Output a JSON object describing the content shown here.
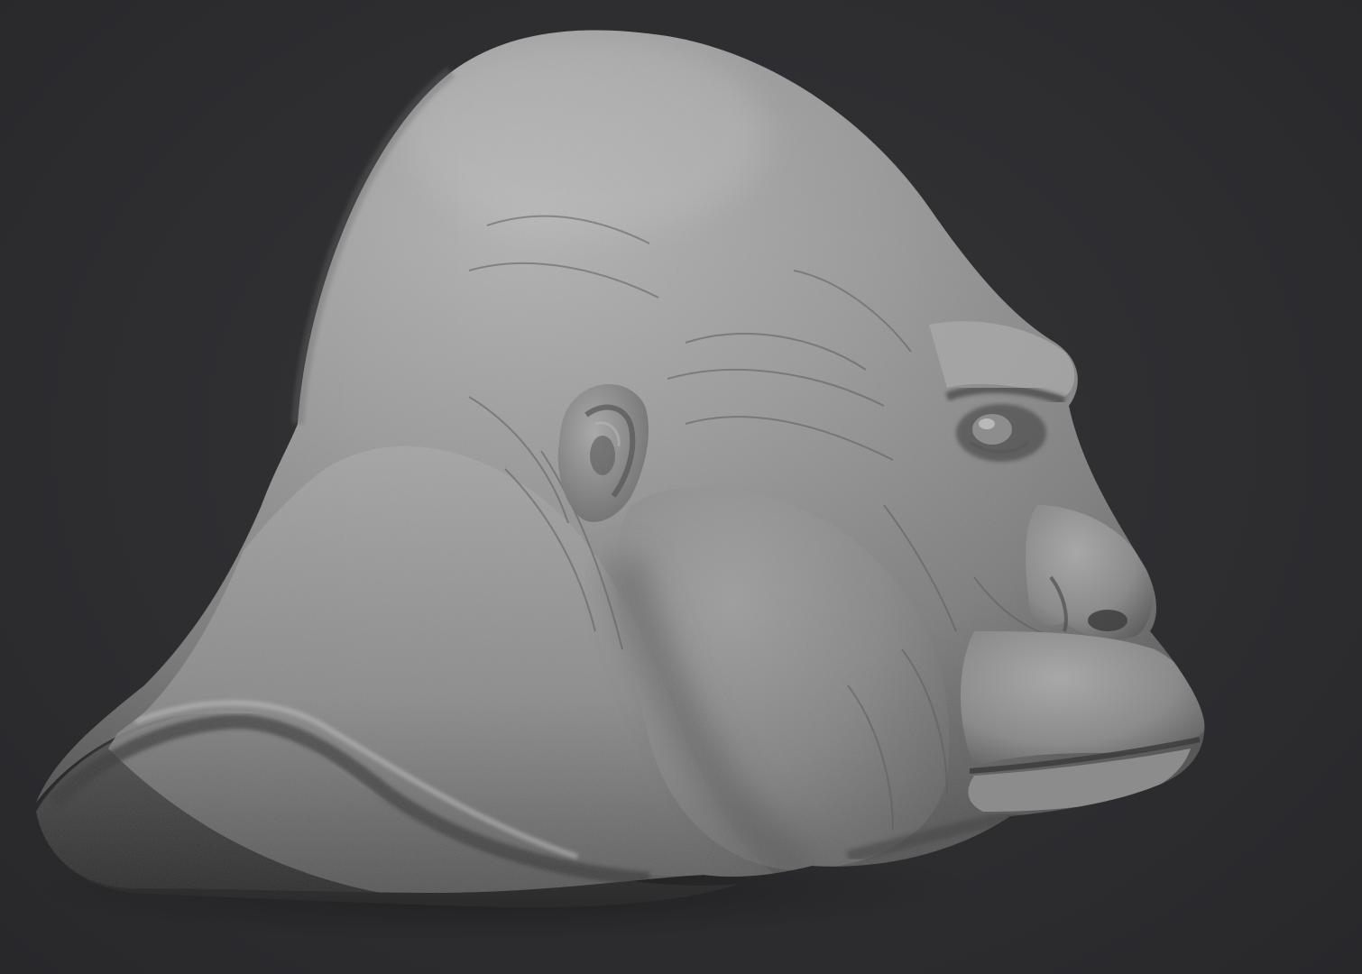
{
  "scene": {
    "background_color": "#2d2d30",
    "material_color": "#8e8e8e",
    "subject": "gorilla-head-sculpt"
  }
}
